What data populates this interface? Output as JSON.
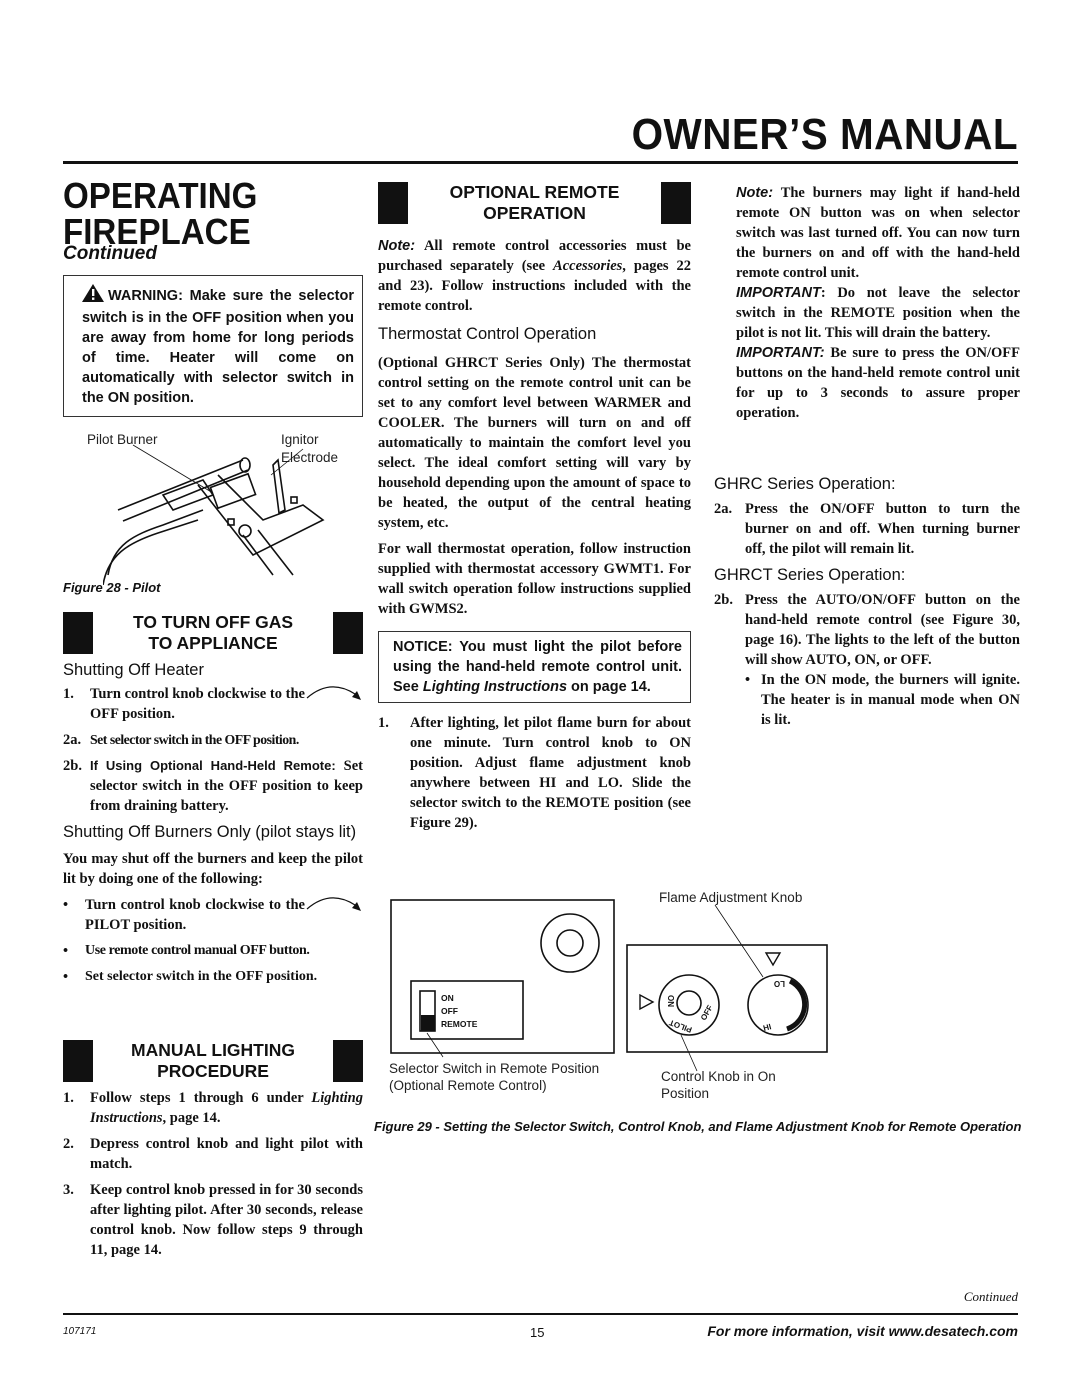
{
  "header": {
    "manual_title": "OWNER’S MANUAL",
    "section_title_line1": "OPERATING",
    "section_title_line2": "FIREPLACE",
    "section_continued": "Continued"
  },
  "warning_box": {
    "icon": "warning-triangle-icon",
    "text": "WARNING: Make sure the selector switch is in the OFF position when you are away from home for long periods of time. Heater will come on automatically with selector switch in the ON position."
  },
  "figure28": {
    "label_pilot_burner": "Pilot Burner",
    "label_ignitor_1": "Ignitor",
    "label_ignitor_2": "Electrode",
    "caption": "Figure 28 - Pilot"
  },
  "turn_off_gas": {
    "heading_line1": "TO TURN OFF GAS",
    "heading_line2": "TO APPLIANCE",
    "sub1": "Shutting Off Heater",
    "steps": [
      {
        "num": "1.",
        "text": "Turn control knob clockwise to the OFF position."
      },
      {
        "num": "2a.",
        "text": "Set selector switch in the OFF position."
      },
      {
        "num": "2b.",
        "text_sans": "If Using Optional Hand-Held Remote:",
        "text": "Set selector switch in the OFF position to keep from draining battery."
      }
    ],
    "sub2": "Shutting Off Burners Only (pilot stays lit)",
    "intro": "You may shut off the burners and keep the pilot lit by doing one of the following:",
    "bullets": [
      "Turn control knob clockwise to the PILOT position.",
      "Use remote control manual OFF button.",
      "Set selector switch in the OFF position."
    ]
  },
  "manual_lighting": {
    "heading_line1": "MANUAL LIGHTING",
    "heading_line2": "PROCEDURE",
    "steps": [
      {
        "num": "1.",
        "text_a": "Follow steps 1 through 6 under ",
        "text_it": "Lighting Instructions",
        "text_b": ", page 14."
      },
      {
        "num": "2.",
        "text": "Depress control knob and light pilot with match."
      },
      {
        "num": "3.",
        "text": "Keep control knob pressed in for 30 seconds after lighting pilot. After 30 seconds, release control knob. Now follow steps 9 through 11, page 14."
      }
    ]
  },
  "remote_operation": {
    "heading_line1": "OPTIONAL REMOTE",
    "heading_line2": "OPERATION",
    "note_label": "Note:",
    "note_a": " All remote control accessories must be purchased separately (see ",
    "note_it": "Accessories",
    "note_b": ", pages 22 and 23). Follow instructions included with the remote control.",
    "thermostat_heading": "Thermostat Control Operation",
    "thermostat_p1": "(Optional GHRCT Series Only) The thermostat control setting on the remote control unit can be set to any comfort level between WARMER and COOLER. The burners will turn on and off automatically to maintain the comfort level you select. The ideal comfort setting will vary by household depending upon the amount of space to be heated, the output of the central heating system, etc.",
    "thermostat_p2": "For wall thermostat operation, follow instruction supplied with thermostat accessory GWMT1. For wall switch operation follow instructions supplied with GWMS2.",
    "notice_a": "NOTICE: You must light the pilot before using the hand-held remote control unit. See ",
    "notice_it": "Lighting Instructions",
    "notice_b": " on page 14.",
    "step1_num": "1.",
    "step1": "After lighting, let pilot flame burn for about one minute. Turn control knob to ON position. Adjust flame adjustment knob anywhere between HI and LO. Slide the selector switch to the REMOTE position (see Figure 29)."
  },
  "right_column": {
    "note_label": "Note:",
    "note": " The burners may light if hand-held remote ON button was on when selector switch was last turned off. You can now turn the burners on and off with the hand-held remote control unit.",
    "important1_label": "IMPORTANT",
    "important1": ": Do not leave the selector switch in the REMOTE position when the pilot is not lit. This will drain the battery.",
    "important2_label": "IMPORTANT:",
    "important2": " Be sure to press the ON/OFF buttons on the hand-held remote control unit for up to 3 seconds to assure proper operation.",
    "ghrc_heading": "GHRC Series Operation:",
    "ghrc_step_num": "2a.",
    "ghrc_step": "Press the ON/OFF button to turn the burner on and off. When turning burner off, the pilot will remain lit.",
    "ghrct_heading": "GHRCT Series Operation:",
    "ghrct_step_num": "2b.",
    "ghrct_step": "Press the AUTO/ON/OFF button on the hand-held remote control (see Figure 30, page 16). The lights to the left of the button will show AUTO, ON, or OFF.",
    "ghrct_bullet": "In the ON mode, the burners will ignite. The heater is in manual mode when ON is lit."
  },
  "figure29": {
    "switch_on": "ON",
    "switch_off": "OFF",
    "switch_remote": "REMOTE",
    "selected_position": "REMOTE",
    "knob_on": "ON",
    "knob_off": "OFF",
    "knob_pilot": "PILOT",
    "flame_lo": "LO",
    "flame_hi": "HI",
    "label_flame": "Flame Adjustment Knob",
    "label_selector_1": "Selector Switch in Remote Position",
    "label_selector_2": "(Optional Remote Control)",
    "label_control_1": "Control Knob in On",
    "label_control_2": "Position",
    "caption": "Figure 29 - Setting the Selector Switch, Control Knob, and Flame Adjustment Knob for Remote Operation"
  },
  "footer": {
    "continued": "Continued",
    "doc_number": "107171",
    "page_number": "15",
    "more_info": "For more information, visit www.desatech.com"
  }
}
